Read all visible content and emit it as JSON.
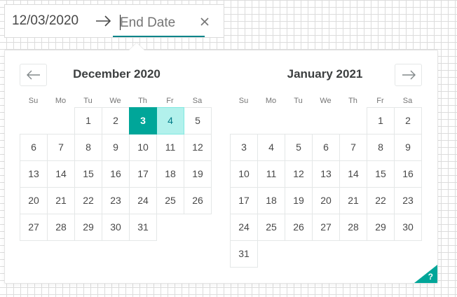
{
  "input": {
    "start_date": "12/03/2020",
    "end_date_value": "",
    "end_date_placeholder": "End Date"
  },
  "colors": {
    "selected": "#00a699",
    "hovered": "#b2f1ec",
    "hovered_text": "#007a87",
    "focus_underline": "#008489"
  },
  "calendar": {
    "weekdays": [
      "Su",
      "Mo",
      "Tu",
      "We",
      "Th",
      "Fr",
      "Sa"
    ],
    "months": [
      {
        "title": "December 2020",
        "first_weekday": 2,
        "days": 31,
        "selected": [
          3
        ],
        "hovered": [
          4
        ]
      },
      {
        "title": "January 2021",
        "first_weekday": 5,
        "days": 31,
        "selected": [],
        "hovered": []
      }
    ]
  },
  "help_label": "?"
}
